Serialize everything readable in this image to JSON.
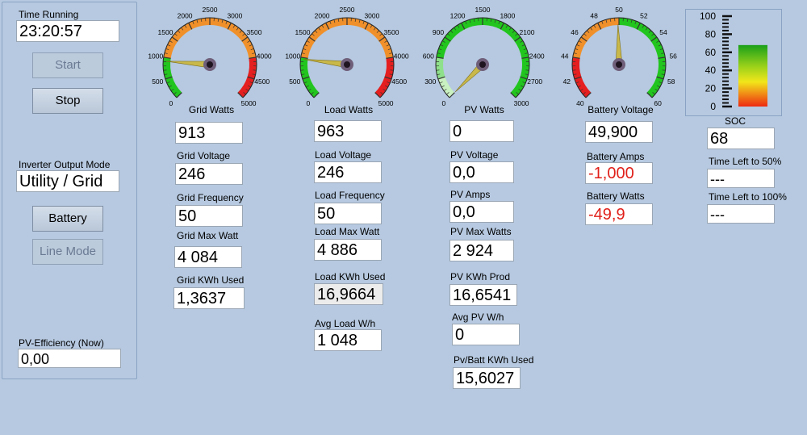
{
  "left": {
    "time_running_label": "Time Running",
    "time_running_value": "23:20:57",
    "start_label": "Start",
    "stop_label": "Stop",
    "inverter_mode_label": "Inverter Output Mode",
    "inverter_mode_value": "Utility / Grid",
    "battery_label": "Battery",
    "line_mode_label": "Line Mode",
    "pv_efficiency_label": "PV-Efficiency (Now)",
    "pv_efficiency_value": "0,00"
  },
  "grid": {
    "gauge_title": "Grid Watts",
    "gauge_ticks": [
      "0",
      "500",
      "1000",
      "1500",
      "2000",
      "2500",
      "3000",
      "3500",
      "4000",
      "4500",
      "5000"
    ],
    "gauge_value": 913,
    "watts": "913",
    "voltage_label": "Grid Voltage",
    "voltage": "246",
    "frequency_label": "Grid Frequency",
    "frequency": "50",
    "max_watt_label": "Grid Max Watt",
    "max_watt": "4 084",
    "kwh_label": "Grid KWh Used",
    "kwh": "1,3637"
  },
  "load": {
    "gauge_title": "Load Watts",
    "gauge_ticks": [
      "0",
      "500",
      "1000",
      "1500",
      "2000",
      "2500",
      "3000",
      "3500",
      "4000",
      "4500",
      "5000"
    ],
    "gauge_value": 963,
    "watts": "963",
    "voltage_label": "Load Voltage",
    "voltage": "246",
    "frequency_label": "Load Frequency",
    "frequency": "50",
    "max_watt_label": "Load Max Watt",
    "max_watt": "4 886",
    "kwh_label": "Load KWh Used",
    "kwh": "16,9664",
    "avg_label": "Avg Load W/h",
    "avg": "1 048"
  },
  "pv": {
    "gauge_title": "PV Watts",
    "gauge_ticks": [
      "0",
      "300",
      "600",
      "900",
      "1200",
      "1500",
      "1800",
      "2100",
      "2400",
      "2700",
      "3000"
    ],
    "gauge_value": 0,
    "watts": "0",
    "voltage_label": "PV Voltage",
    "voltage": "0,0",
    "amps_label": "PV Amps",
    "amps": "0,0",
    "max_watts_label": "PV Max Watts",
    "max_watts": "2 924",
    "kwh_prod_label": "PV KWh Prod",
    "kwh_prod": "16,6541",
    "avg_label": "Avg PV W/h",
    "avg": "0",
    "batt_kwh_label": "Pv/Batt KWh Used",
    "batt_kwh": "15,6027"
  },
  "battery": {
    "gauge_title": "Battery Voltage",
    "gauge_ticks": [
      "40",
      "42",
      "44",
      "46",
      "48",
      "50",
      "52",
      "54",
      "56",
      "58",
      "60"
    ],
    "gauge_value": 49.9,
    "voltage": "49,900",
    "amps_label": "Battery Amps",
    "amps": "-1,000",
    "watts_label": "Battery Watts",
    "watts": "-49,9"
  },
  "soc": {
    "scale": [
      "100",
      "80",
      "60",
      "40",
      "20",
      "0"
    ],
    "level_percent": 68,
    "label": "SOC",
    "value": "68",
    "time50_label": "Time Left to 50%",
    "time50": "---",
    "time100_label": "Time Left to 100%",
    "time100": "---"
  },
  "colors": {
    "background": "#b6c9e0",
    "green": "#22c51e",
    "orange": "#f0902a",
    "red": "#e51f1f",
    "needle": "#c9b84a",
    "red_text": "#e0201a"
  }
}
